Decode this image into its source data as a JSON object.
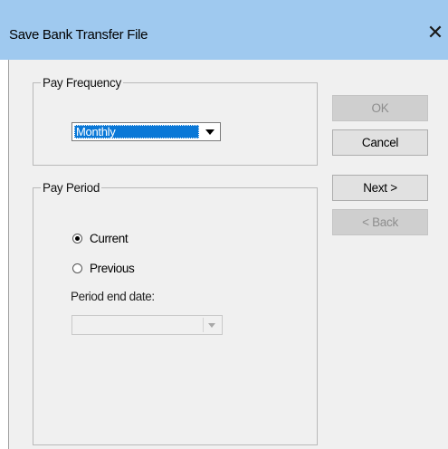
{
  "dialog": {
    "title": "Save Bank Transfer File",
    "close_glyph": "✕"
  },
  "pay_frequency": {
    "legend": "Pay Frequency",
    "selected": "Monthly"
  },
  "pay_period": {
    "legend": "Pay Period",
    "options": [
      {
        "label": "Current",
        "checked": true
      },
      {
        "label": "Previous",
        "checked": false
      }
    ],
    "end_date_label": "Period end date:",
    "end_date_value": ""
  },
  "buttons": {
    "ok": "OK",
    "cancel": "Cancel",
    "next": "Next >",
    "back": "< Back"
  },
  "colors": {
    "titlebar": "#9fc9ef",
    "selection": "#0a78d7",
    "client_bg": "#f0f0f0"
  }
}
